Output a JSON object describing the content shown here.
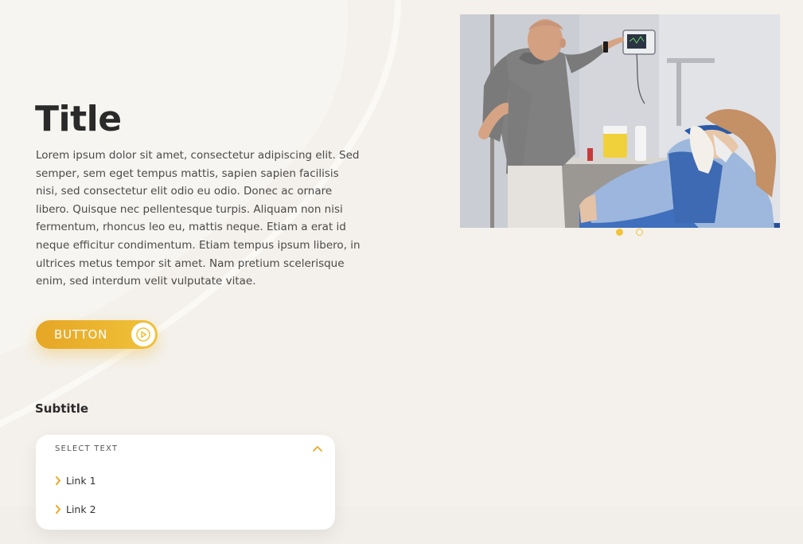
{
  "hero": {
    "title": "Title",
    "body": "Lorem ipsum dolor sit amet, consectetur adipiscing elit. Sed semper, sem eget tempus mattis, sapien sapien facilisis nisi, sed consectetur elit odio eu odio. Donec ac ornare libero. Quisque nec pellentesque turpis. Aliquam non nisi fermentum, rhoncus leo eu, mattis neque. Etiam a erat id neque efficitur condimentum. Etiam tempus ipsum libero, in ultrices metus tempor sit amet. Nam pretium scelerisque enim, sed interdum velit vulputate vitae.",
    "button_label": "BUTTON",
    "button_icon": "play-circle-icon"
  },
  "section": {
    "subtitle": "Subtitle",
    "dropdown": {
      "label": "SELECT TEXT",
      "expanded": true,
      "toggle_icon": "chevron-up-icon",
      "item_icon": "chevron-right-icon",
      "links": [
        {
          "label": "Link 1"
        },
        {
          "label": "Link 2"
        }
      ]
    }
  },
  "carousel": {
    "slide_count": 2,
    "active_index": 0,
    "image_content": "man in grey polo adjusting a wall-mounted monitor next to a woman in a blue sweater reclining in a treatment chair"
  },
  "colors": {
    "background": "#f4f1ec",
    "accent": "#f1c33a",
    "accent_dark": "#e5a625",
    "text": "#2a2a2a",
    "card": "#ffffff"
  }
}
